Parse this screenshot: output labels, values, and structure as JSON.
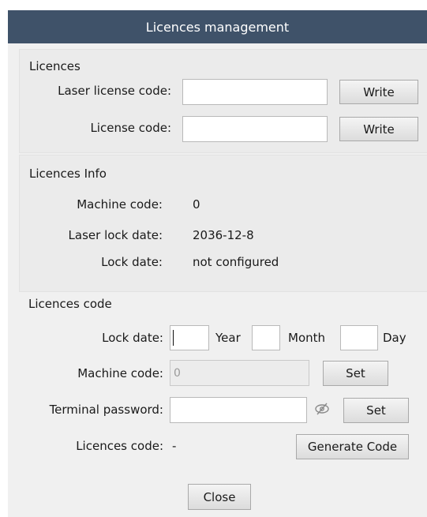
{
  "dialog": {
    "title": "Licences management"
  },
  "licences": {
    "heading": "Licences",
    "laser_code_label": "Laser license code:",
    "laser_code_value": "",
    "license_code_label": "License code:",
    "license_code_value": "",
    "write_label": "Write"
  },
  "info": {
    "heading": "Licences Info",
    "machine_code_label": "Machine code:",
    "machine_code_value": "0",
    "laser_lock_date_label": "Laser lock date:",
    "laser_lock_date_value": "2036-12-8",
    "lock_date_label": "Lock date:",
    "lock_date_value": "not configured"
  },
  "code": {
    "heading": "Licences code",
    "lock_date_label": "Lock date:",
    "year_label": "Year",
    "month_label": "Month",
    "day_label": "Day",
    "year_value": "",
    "month_value": "",
    "day_value": "",
    "machine_code_label": "Machine code:",
    "machine_code_value": "0",
    "set_label": "Set",
    "terminal_password_label": "Terminal password:",
    "terminal_password_value": "",
    "licences_code_label": "Licences code:",
    "licences_code_value": "-",
    "generate_label": "Generate Code"
  },
  "footer": {
    "close_label": "Close"
  },
  "icons": {
    "password_toggle": "eye-slash-icon"
  }
}
